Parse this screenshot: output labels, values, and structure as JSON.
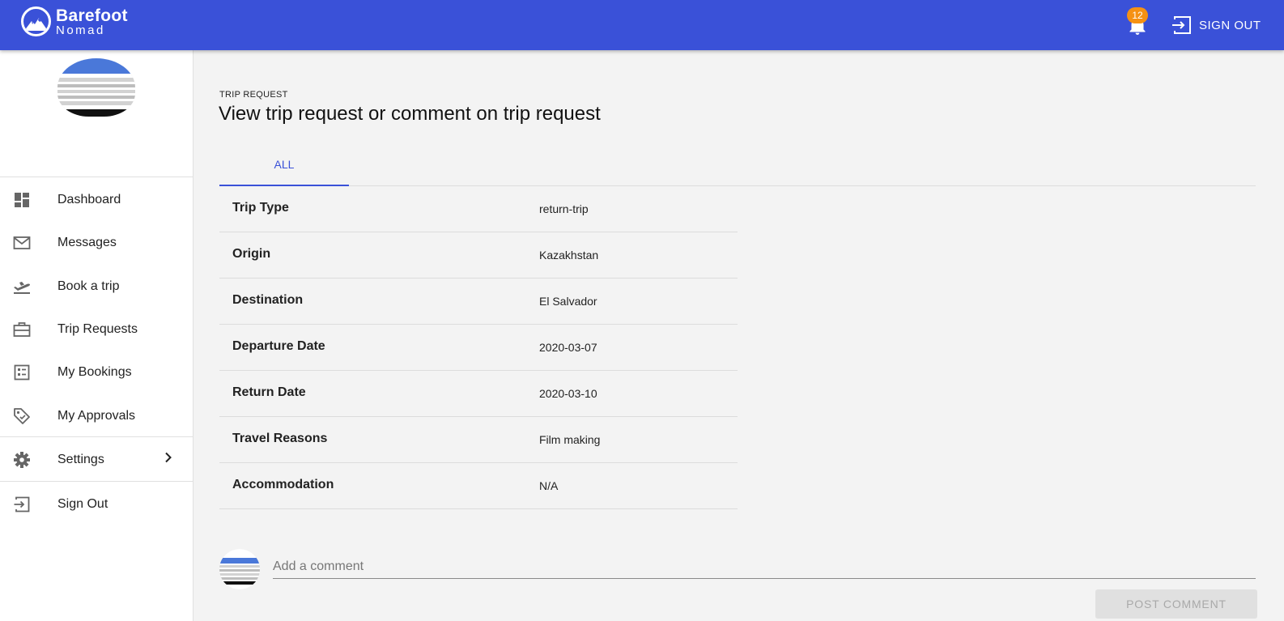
{
  "app": {
    "brand_line1": "Barefoot",
    "brand_line2": "Nomad",
    "accent_color": "#3a51d8",
    "badge_color": "#f59114"
  },
  "header": {
    "notification_count": "12",
    "sign_out_label": "SIGN OUT",
    "icons": [
      "logo-mountain-icon",
      "bell-icon",
      "sign-out-icon"
    ]
  },
  "sidebar": {
    "items": [
      {
        "label": "Dashboard",
        "icon": "dashboard-icon"
      },
      {
        "label": "Messages",
        "icon": "mail-icon"
      },
      {
        "label": "Book a trip",
        "icon": "flight-takeoff-icon"
      },
      {
        "label": "Trip Requests",
        "icon": "briefcase-icon"
      },
      {
        "label": "My Bookings",
        "icon": "list-alt-icon"
      },
      {
        "label": "My Approvals",
        "icon": "tag-icon"
      },
      {
        "label": "Settings",
        "icon": "gear-icon"
      },
      {
        "label": "Sign Out",
        "icon": "sign-out-icon"
      }
    ]
  },
  "main": {
    "overline": "TRIP REQUEST",
    "title": "View trip request or comment on trip request",
    "tabs": [
      {
        "label": "ALL"
      }
    ],
    "details": [
      {
        "label": "Trip Type",
        "value": "return-trip"
      },
      {
        "label": "Origin",
        "value": "Kazakhstan"
      },
      {
        "label": "Destination",
        "value": "El Salvador"
      },
      {
        "label": "Departure Date",
        "value": "2020-03-07"
      },
      {
        "label": "Return Date",
        "value": "2020-03-10"
      },
      {
        "label": "Travel Reasons",
        "value": "Film making"
      },
      {
        "label": "Accommodation",
        "value": "N/A"
      }
    ]
  },
  "comment": {
    "placeholder": "Add a comment",
    "value": "",
    "post_label": "POST COMMENT"
  }
}
